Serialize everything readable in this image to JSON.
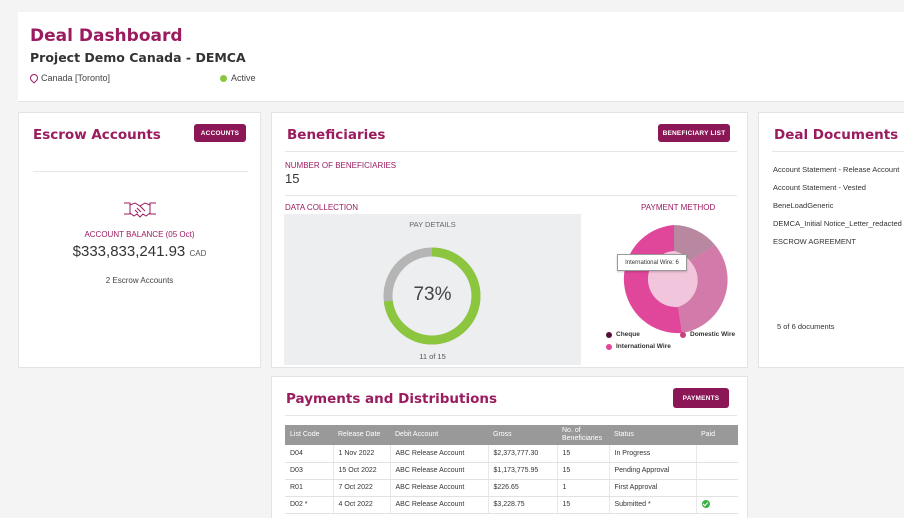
{
  "header": {
    "title": "Deal Dashboard",
    "subtitle": "Project Demo Canada - DEMCA",
    "location": "Canada [Toronto]",
    "status": "Active",
    "status_color": "#8cc63f"
  },
  "escrow": {
    "title": "Escrow Accounts",
    "button": "ACCOUNTS",
    "balance_label": "ACCOUNT BALANCE (05 Oct)",
    "balance_amount": "$333,833,241.93",
    "balance_currency": "CAD",
    "count_text": "2 Escrow Accounts",
    "icon": "handshake-icon"
  },
  "beneficiaries": {
    "title": "Beneficiaries",
    "button": "BENEFICIARY LIST",
    "count_label": "NUMBER OF BENEFICIARIES",
    "count_value": "15",
    "data_collection_label": "DATA COLLECTION",
    "pay_details_label": "PAY DETAILS",
    "pay_details_percent_text": "73%",
    "pay_details_fraction": 0.73,
    "pay_details_of": "11 of 15",
    "payment_method_label": "PAYMENT METHOD",
    "tooltip_text": "International Wire: 6",
    "legend": [
      {
        "label": "Cheque",
        "color": "#5a0f38"
      },
      {
        "label": "Domestic Wire",
        "color": "#c7407f"
      },
      {
        "label": "International Wire",
        "color": "#e0479a"
      }
    ]
  },
  "documents": {
    "title": "Deal Documents",
    "items": [
      "Account Statement - Release Account",
      "Account Statement - Vested",
      "BeneLoadGeneric",
      "DEMCA_Initial Notice_Letter_redacted",
      "ESCROW AGREEMENT"
    ],
    "count_text": "5 of 6 documents"
  },
  "payments": {
    "title": "Payments and Distributions",
    "button": "PAYMENTS",
    "columns": [
      "List Code",
      "Release Date",
      "Debit Account",
      "Gross",
      "No. of Beneficiaries",
      "Status",
      "Paid"
    ],
    "rows": [
      [
        "D04",
        "1 Nov 2022",
        "ABC Release Account",
        "$2,373,777.30",
        "15",
        "In Progress",
        ""
      ],
      [
        "D03",
        "15 Oct 2022",
        "ABC Release Account",
        "$1,173,775.95",
        "15",
        "Pending Approval",
        ""
      ],
      [
        "R01",
        "7 Oct 2022",
        "ABC Release Account",
        "$226.65",
        "1",
        "First Approval",
        ""
      ],
      [
        "D02 *",
        "4 Oct 2022",
        "ABC Release Account",
        "$3,228.75",
        "15",
        "Submitted *",
        "check"
      ]
    ]
  }
}
